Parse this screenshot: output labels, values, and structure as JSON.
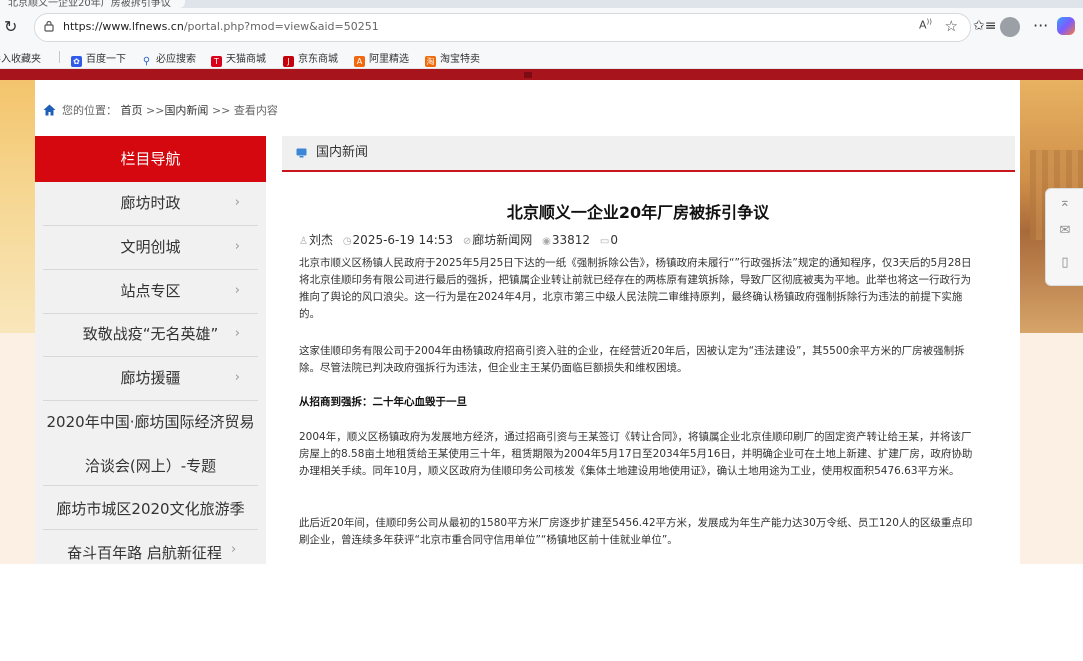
{
  "browser": {
    "tab_title": "北京顺义一企业20年厂房被拆引争议",
    "url_host": "https://www.lfnews.cn",
    "url_path": "/portal.php?mod=view&aid=50251",
    "bookmarks": [
      {
        "label": "导入收藏夹",
        "icon": ""
      },
      {
        "label": "百度一下",
        "icon": "baidu-icon",
        "color": "#2f5be8"
      },
      {
        "label": "必应搜索",
        "icon": "search-icon",
        "color": "#2f66c6"
      },
      {
        "label": "天猫商城",
        "icon": "tmall-icon",
        "color": "#d8001a"
      },
      {
        "label": "京东商城",
        "icon": "jd-icon",
        "color": "#c4000b"
      },
      {
        "label": "阿里精选",
        "icon": "ali-icon",
        "color": "#f2680e"
      },
      {
        "label": "淘宝特卖",
        "icon": "taobao-icon",
        "color": "#f26b0a"
      }
    ]
  },
  "breadcrumb": {
    "label": "您的位置：",
    "home": "首页",
    "sep1": ">>",
    "category": "国内新闻",
    "sep2": ">>",
    "current": "查看内容"
  },
  "sidebar": {
    "title": "栏目导航",
    "items": [
      {
        "label": "廊坊时政",
        "chevron": "›"
      },
      {
        "label": "文明创城",
        "chevron": "›"
      },
      {
        "label": "站点专区",
        "chevron": "›"
      },
      {
        "label": "致敬战疫“无名英雄”",
        "chevron": "›"
      },
      {
        "label": "廊坊援疆",
        "chevron": "›"
      }
    ],
    "wide_item_line1": "2020年中国·廊坊国际经济贸易",
    "wide_item_line2": "洽谈会(网上）-专题",
    "item_culture": "廊坊市城区2020文化旅游季",
    "item_century": "奋斗百年路 启航新征程",
    "item_century_chevron": "›"
  },
  "column": {
    "title": "国内新闻"
  },
  "article": {
    "title": "北京顺义一企业20年厂房被拆引争议",
    "author": "刘杰",
    "datetime": "2025-6-19 14:53",
    "source": "廊坊新闻网",
    "views": "33812",
    "comments": "0",
    "p1": "北京市顺义区杨镇人民政府于2025年5月25日下达的一纸《强制拆除公告》，杨镇政府未履行“”行政强拆法”规定的通知程序，仅3天后的5月28日将北京佳顺印务有限公司进行最后的强拆，把镇属企业转让前就已经存在的两栋原有建筑拆除，导致厂区彻底被夷为平地。此举也将这一行政行为推向了舆论的风口浪尖。这一行为是在2024年4月，北京市第三中级人民法院二审维持原判，最终确认杨镇政府强制拆除行为违法的前提下实施的。",
    "p2": "这家佳顺印务有限公司于2004年由杨镇政府招商引资入驻的企业，在经营近20年后，因被认定为“违法建设”，其5500余平方米的厂房被强制拆除。尽管法院已判决政府强拆行为违法，但企业主王某仍面临巨额损失和维权困境。",
    "subhead": "从招商到强拆：二十年心血毁于一旦",
    "p3": "2004年，顺义区杨镇政府为发展地方经济，通过招商引资与王某签订《转让合同》，将镇属企业北京佳顺印刷厂的固定资产转让给王某，并将该厂房屋上的8.58亩土地租赁给王某使用三十年，租赁期限为2004年5月17日至2034年5月16日，并明确企业可在土地上新建、扩建厂房，政府协助办理相关手续。同年10月，顺义区政府为佳顺印务公司核发《集体土地建设用地使用证》，确认土地用途为工业，使用权面积5476.63平方米。",
    "p4": "此后近20年间，佳顺印务公司从最初的1580平方米厂房逐步扩建至5456.42平方米，发展成为年生产能力达30万令纸、员工120人的区级重点印刷企业，曾连续多年获评“北京市重合同守信用单位”“杨镇地区前十佳就业单位”。"
  },
  "colors": {
    "nav_red": "#d6080f",
    "accent_red": "#c8161d",
    "top_bar": "#a8141b"
  }
}
